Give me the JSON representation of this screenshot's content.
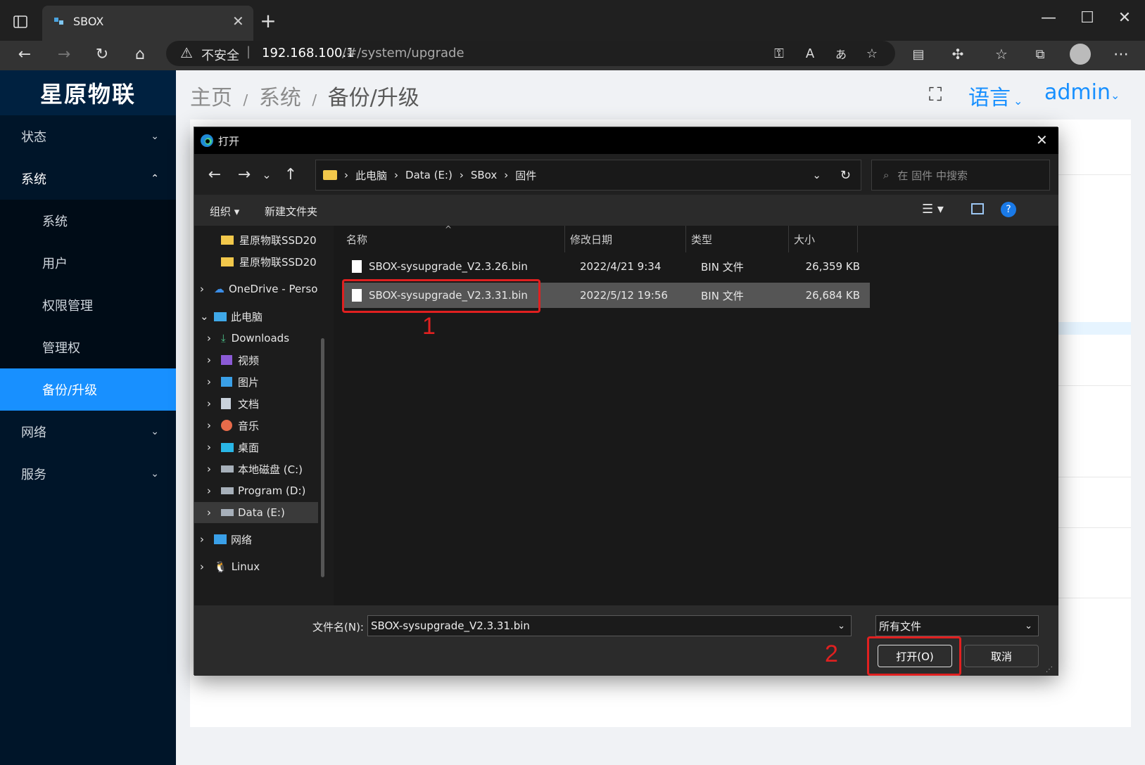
{
  "browser": {
    "tab_title": "SBOX",
    "url_warning": "不安全",
    "url_host": "192.168.100.1",
    "url_path": "/#/system/upgrade"
  },
  "sidebar": {
    "logo": "星原物联",
    "items": [
      {
        "label": "状态",
        "chevron": "down"
      },
      {
        "label": "系统",
        "chevron": "up"
      },
      {
        "label": "系统"
      },
      {
        "label": "用户"
      },
      {
        "label": "权限管理"
      },
      {
        "label": "管理权"
      },
      {
        "label": "备份/升级",
        "active": true
      },
      {
        "label": "网络",
        "chevron": "down"
      },
      {
        "label": "服务",
        "chevron": "down"
      }
    ]
  },
  "header": {
    "crumb_home": "主页",
    "crumb_system": "系统",
    "crumb_current": "备份/升级",
    "sep": "/",
    "language": "语言",
    "user": "admin"
  },
  "dialog": {
    "title": "打开",
    "path": [
      "此电脑",
      "Data (E:)",
      "SBox",
      "固件"
    ],
    "search_placeholder": "在 固件 中搜索",
    "organize": "组织",
    "new_folder": "新建文件夹",
    "tree": [
      {
        "label": "星原物联SSD20",
        "type": "folder"
      },
      {
        "label": "星原物联SSD20",
        "type": "folder"
      },
      {
        "label": "OneDrive - Perso",
        "type": "cloud"
      },
      {
        "label": "此电脑",
        "type": "pc",
        "expanded": true
      },
      {
        "label": "Downloads",
        "type": "download"
      },
      {
        "label": "视频",
        "type": "video"
      },
      {
        "label": "图片",
        "type": "picture"
      },
      {
        "label": "文档",
        "type": "document"
      },
      {
        "label": "音乐",
        "type": "music"
      },
      {
        "label": "桌面",
        "type": "desktop"
      },
      {
        "label": "本地磁盘 (C:)",
        "type": "drive"
      },
      {
        "label": "Program (D:)",
        "type": "drive"
      },
      {
        "label": "Data (E:)",
        "type": "drive",
        "selected": true
      },
      {
        "label": "网络",
        "type": "network"
      },
      {
        "label": "Linux",
        "type": "linux"
      }
    ],
    "columns": [
      "名称",
      "修改日期",
      "类型",
      "大小"
    ],
    "files": [
      {
        "name": "SBOX-sysupgrade_V2.3.26.bin",
        "date": "2022/4/21 9:34",
        "type": "BIN 文件",
        "size": "26,359 KB"
      },
      {
        "name": "SBOX-sysupgrade_V2.3.31.bin",
        "date": "2022/5/12 19:56",
        "type": "BIN 文件",
        "size": "26,684 KB",
        "selected": true
      }
    ],
    "filename_label": "文件名(N):",
    "filename_value": "SBOX-sysupgrade_V2.3.31.bin",
    "filter": "所有文件",
    "open_button": "打开(O)",
    "cancel_button": "取消"
  },
  "annotations": {
    "step1": "1",
    "step2": "2",
    "color": "#e02020"
  },
  "colors": {
    "sidebar_bg": "#001529",
    "active": "#1890ff",
    "accent": "#1890ff"
  }
}
